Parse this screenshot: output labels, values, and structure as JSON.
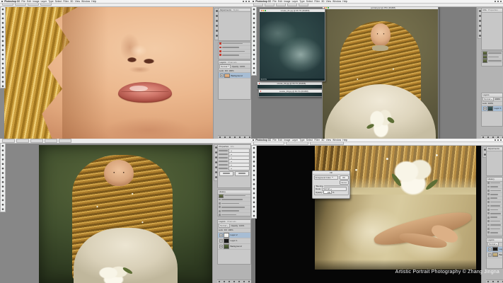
{
  "watermark": "Artistic Portrait Photography © Zhang Jingna",
  "menubar": {
    "app_name": "Photoshop CC",
    "menus": [
      "File",
      "Edit",
      "Image",
      "Layer",
      "Type",
      "Select",
      "Filter",
      "3D",
      "View",
      "Window",
      "Help"
    ]
  },
  "windows": {
    "smoke1_title": "smoke_01.jpg @ 66.7% (RGB/8)",
    "smoke2_title": "smoke_02.jpg @ 66.7% (RGB/8)",
    "smoke3_title": "smoke_03.jpg @ 66.7% (RGB/8)",
    "smoke1_status": "66.67%",
    "portrait_title": "portrait.psd @ 25% (RGB/8)"
  },
  "panels": {
    "layers_tab": "Layers",
    "channels_tab": "Channels",
    "paths_tab": "Paths",
    "history_tab": "History",
    "adjustments_tab": "Adjustments",
    "styles_tab": "Styles",
    "properties_tab": "Properties",
    "info_tab": "Info",
    "blend_mode": "Normal",
    "opacity_label": "Opacity:",
    "opacity_value": "100%",
    "lock_label": "Lock:",
    "fill_label": "Fill:",
    "fill_value": "100%",
    "layer_background": "Background",
    "layer_1": "Layer 1",
    "layer_2": "Layer 2"
  },
  "dialog": {
    "title": "Fill",
    "contents_value": "Foreground Color",
    "ok": "OK",
    "cancel": "Cancel",
    "blending_label": "Blending",
    "mode_label": "Mode:",
    "mode_value": "Normal",
    "opacity_label": "Opacity:",
    "opacity_value": "100",
    "percent": "%"
  },
  "colors": {
    "pasteboard": "#7e7e7e",
    "panel_bg": "#b3b3b3",
    "menu_bg": "#f4f4f4",
    "canvas_black": "#060606",
    "smoke_teal": "#24393c",
    "hair_gold": "#d4a94e",
    "skin": "#f0c9a4",
    "portrait_green": "#615c40",
    "green_dark": "#41502e",
    "watermark_text": "#f5f5f5"
  }
}
